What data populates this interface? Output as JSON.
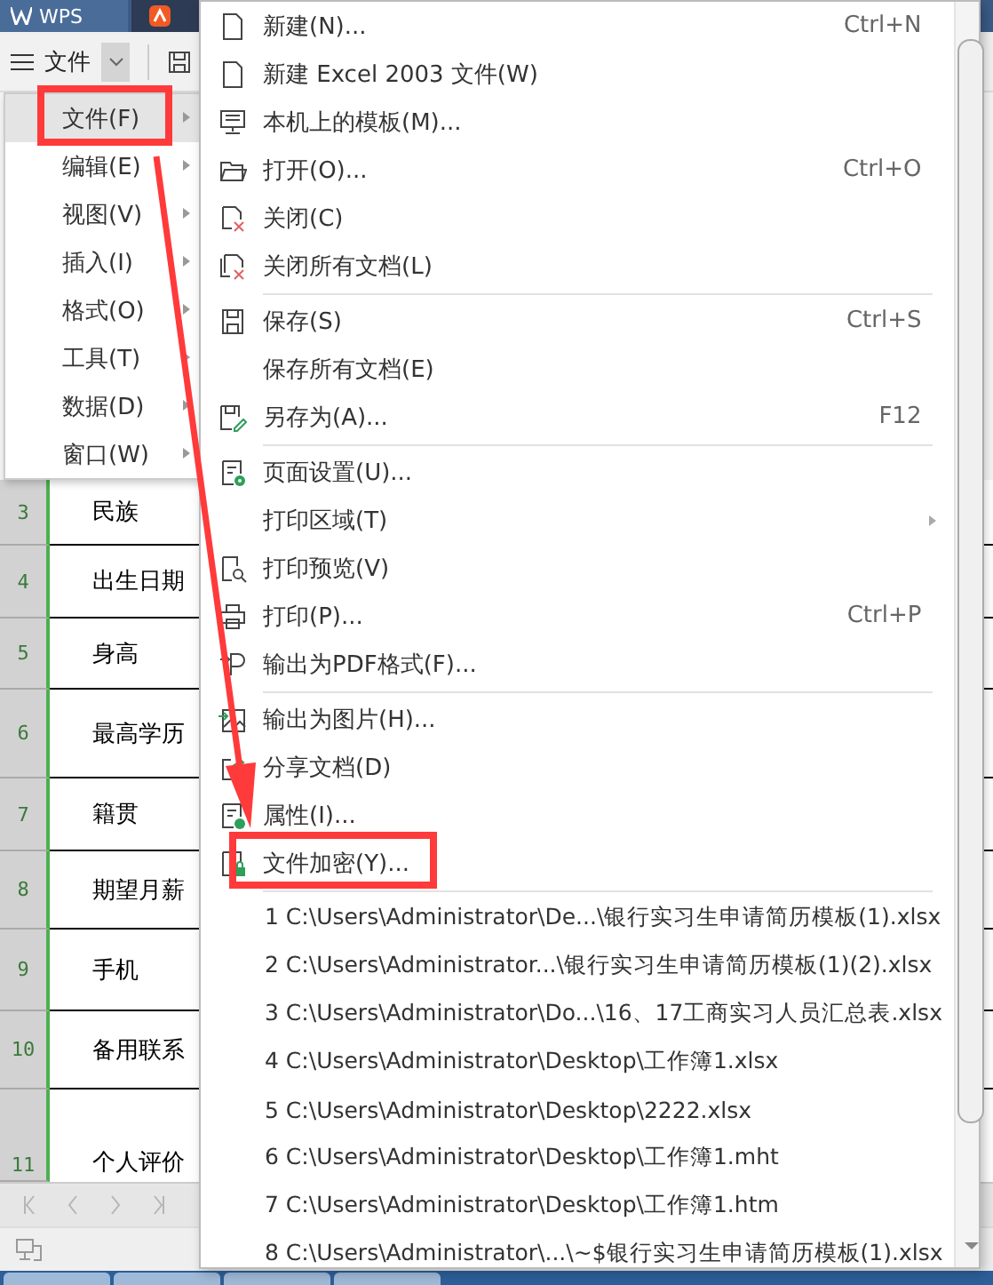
{
  "title_bar": {
    "app_tab": {
      "label": "WPS"
    }
  },
  "toolbar": {
    "menu_label": "文件"
  },
  "menu": {
    "items": [
      {
        "label": "文件(F)",
        "selected": true,
        "annotated": true
      },
      {
        "label": "编辑(E)",
        "selected": false,
        "annotated": false
      },
      {
        "label": "视图(V)",
        "selected": false,
        "annotated": false
      },
      {
        "label": "插入(I)",
        "selected": false,
        "annotated": false
      },
      {
        "label": "格式(O)",
        "selected": false,
        "annotated": false
      },
      {
        "label": "工具(T)",
        "selected": false,
        "annotated": false
      },
      {
        "label": "数据(D)",
        "selected": false,
        "annotated": false
      },
      {
        "label": "窗口(W)",
        "selected": false,
        "annotated": false
      }
    ]
  },
  "file_menu": {
    "groups": [
      [
        {
          "label": "新建(N)...",
          "shortcut": "Ctrl+N",
          "has_submenu": false,
          "annotated": false
        },
        {
          "label": "新建 Excel 2003 文件(W)",
          "has_submenu": false,
          "annotated": false
        },
        {
          "label": "本机上的模板(M)...",
          "has_submenu": false,
          "annotated": false
        },
        {
          "label": "打开(O)...",
          "shortcut": "Ctrl+O",
          "has_submenu": false,
          "annotated": false
        },
        {
          "label": "关闭(C)",
          "has_submenu": false,
          "annotated": false
        },
        {
          "label": "关闭所有文档(L)",
          "has_submenu": false,
          "annotated": false
        }
      ],
      [
        {
          "label": "保存(S)",
          "shortcut": "Ctrl+S",
          "has_submenu": false,
          "annotated": false
        },
        {
          "label": "保存所有文档(E)",
          "has_submenu": false,
          "annotated": false
        },
        {
          "label": "另存为(A)...",
          "shortcut": "F12",
          "has_submenu": false,
          "annotated": false
        }
      ],
      [
        {
          "label": "页面设置(U)...",
          "has_submenu": false,
          "annotated": false
        },
        {
          "label": "打印区域(T)",
          "has_submenu": true,
          "annotated": false
        },
        {
          "label": "打印预览(V)",
          "has_submenu": false,
          "annotated": false
        },
        {
          "label": "打印(P)...",
          "shortcut": "Ctrl+P",
          "has_submenu": false,
          "annotated": false
        },
        {
          "label": "输出为PDF格式(F)...",
          "has_submenu": false,
          "annotated": false
        }
      ],
      [
        {
          "label": "输出为图片(H)...",
          "has_submenu": false,
          "annotated": false
        },
        {
          "label": "分享文档(D)",
          "has_submenu": false,
          "annotated": false
        },
        {
          "label": "属性(I)...",
          "has_submenu": false,
          "annotated": false
        },
        {
          "label": "文件加密(Y)...",
          "has_submenu": false,
          "annotated": true
        }
      ]
    ],
    "recent_files": [
      "1 C:\\Users\\Administrator\\De...\\银行实习生申请简历模板(1).xlsx",
      "2 C:\\Users\\Administrator...\\银行实习生申请简历模板(1)(2).xlsx",
      "3 C:\\Users\\Administrator\\Do...\\16、17工商实习人员汇总表.xlsx",
      "4 C:\\Users\\Administrator\\Desktop\\工作簿1.xlsx",
      "5 C:\\Users\\Administrator\\Desktop\\2222.xlsx",
      "6 C:\\Users\\Administrator\\Desktop\\工作簿1.mht",
      "7 C:\\Users\\Administrator\\Desktop\\工作簿1.htm",
      "8 C:\\Users\\Administrator\\...\\~$银行实习生申请简历模板(1).xlsx"
    ]
  },
  "sheet": {
    "rows": [
      {
        "number": "3",
        "label": "民族"
      },
      {
        "number": "4",
        "label": "出生日期"
      },
      {
        "number": "5",
        "label": "身高"
      },
      {
        "number": "6",
        "label": "最高学历"
      },
      {
        "number": "7",
        "label": "籍贯"
      },
      {
        "number": "8",
        "label": "期望月薪"
      },
      {
        "number": "9",
        "label": "手机"
      },
      {
        "number": "10",
        "label": "备用联系"
      },
      {
        "number": "11",
        "label": "个人评价"
      }
    ]
  }
}
